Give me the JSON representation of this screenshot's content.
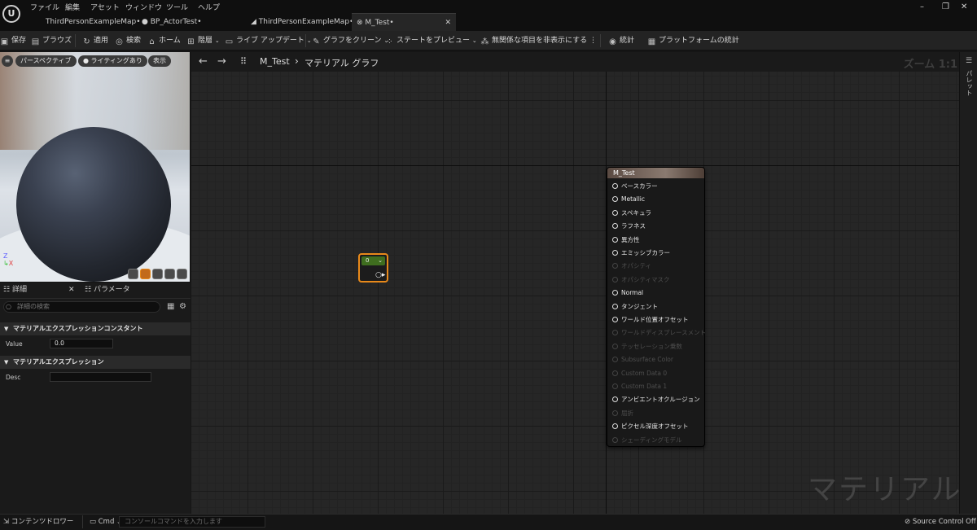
{
  "menu": [
    "ファイル",
    "編集",
    "アセット",
    "ウィンドウ",
    "ツール",
    "ヘルプ"
  ],
  "tabs": [
    {
      "label": "ThirdPersonExampleMap•",
      "icon": "map-icon"
    },
    {
      "label": "BP_ActorTest•",
      "icon": "blueprint-icon"
    },
    {
      "label": "ThirdPersonExampleMap•",
      "icon": "map-icon"
    },
    {
      "label": "M_Test•",
      "icon": "material-icon"
    }
  ],
  "toolbar": {
    "save": "保存",
    "browse": "ブラウズ",
    "apply": "適用",
    "search": "検索",
    "home": "ホーム",
    "hierarchy": "階層",
    "live_update": "ライブ アップデート",
    "clean_graph": "グラフをクリーン",
    "preview_state": "ステートをプレビュー",
    "hide_unrelated": "無関係な項目を非表示にする",
    "stats": "統計",
    "platform_stats": "プラットフォームの統計"
  },
  "viewport": {
    "perspective": "パースペクティブ",
    "lighting": "ライティングあり",
    "show": "表示"
  },
  "details": {
    "tab_details": "詳細",
    "tab_params": "パラメータ",
    "search_placeholder": "詳細の検索",
    "section1": "マテリアルエクスプレッションコンスタント",
    "value_label": "Value",
    "value": "0.0",
    "section2": "マテリアルエクスプレッション",
    "desc_label": "Desc",
    "desc": ""
  },
  "graph": {
    "breadcrumb_asset": "M_Test",
    "breadcrumb_sep": "›",
    "breadcrumb_graph": "マテリアル グラフ",
    "zoom": "ズーム 1:1",
    "watermark": "マテリアル",
    "const_node_value": "0"
  },
  "material_node": {
    "title": "M_Test",
    "pins": [
      {
        "label": "ベースカラー",
        "active": true
      },
      {
        "label": "Metallic",
        "active": true
      },
      {
        "label": "スペキュラ",
        "active": true
      },
      {
        "label": "ラフネス",
        "active": true
      },
      {
        "label": "異方性",
        "active": true
      },
      {
        "label": "エミッシブカラー",
        "active": true
      },
      {
        "label": "オパシティ",
        "active": false
      },
      {
        "label": "オパシティマスク",
        "active": false
      },
      {
        "label": "Normal",
        "active": true
      },
      {
        "label": "タンジェント",
        "active": true
      },
      {
        "label": "ワールド位置オフセット",
        "active": true
      },
      {
        "label": "ワールドディスプレースメント",
        "active": false
      },
      {
        "label": "テッセレーション乗数",
        "active": false
      },
      {
        "label": "Subsurface Color",
        "active": false
      },
      {
        "label": "Custom Data 0",
        "active": false
      },
      {
        "label": "Custom Data 1",
        "active": false
      },
      {
        "label": "アンビエントオクルージョン",
        "active": true
      },
      {
        "label": "屈折",
        "active": false
      },
      {
        "label": "ピクセル深度オフセット",
        "active": true
      },
      {
        "label": "シェーディングモデル",
        "active": false
      }
    ]
  },
  "right_panel": {
    "label": "パレット"
  },
  "statusbar": {
    "content_drawer": "コンテンツドロワー",
    "cmd": "Cmd",
    "cmd_placeholder": "コンソールコマンドを入力します",
    "source_control": "Source Control Off"
  }
}
